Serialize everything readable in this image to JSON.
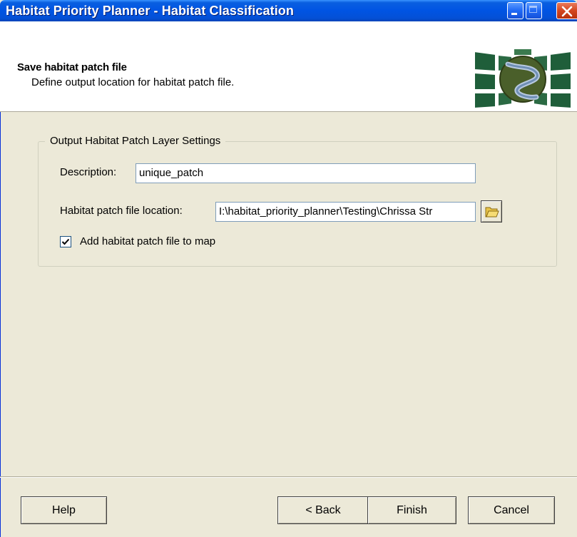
{
  "window": {
    "title": "Habitat Priority Planner - Habitat Classification"
  },
  "header": {
    "title": "Save habitat patch file",
    "subtitle": "Define output location for habitat patch file."
  },
  "group": {
    "legend": "Output Habitat Patch Layer Settings",
    "description_label": "Description:",
    "description_value": "unique_patch",
    "location_label": "Habitat patch file location:",
    "location_value": "I:\\habitat_priority_planner\\Testing\\Chrissa Str",
    "add_to_map_label": "Add habitat patch file to map",
    "add_to_map_checked": true
  },
  "buttons": {
    "help": "Help",
    "back": "< Back",
    "finish": "Finish",
    "cancel": "Cancel"
  },
  "icons": {
    "minimize": "minimize-icon",
    "maximize": "maximize-icon",
    "close": "close-icon",
    "logo": "habitat-planner-logo",
    "browse": "folder-open-icon",
    "check": "checkmark-icon"
  },
  "colors": {
    "titlebar": "#0054e3",
    "dialog_bg": "#ece9d8",
    "header_bg": "#ffffff",
    "close_button": "#d3461f",
    "logo_green": "#1f5e3a",
    "logo_olive": "#4a5f2a"
  }
}
